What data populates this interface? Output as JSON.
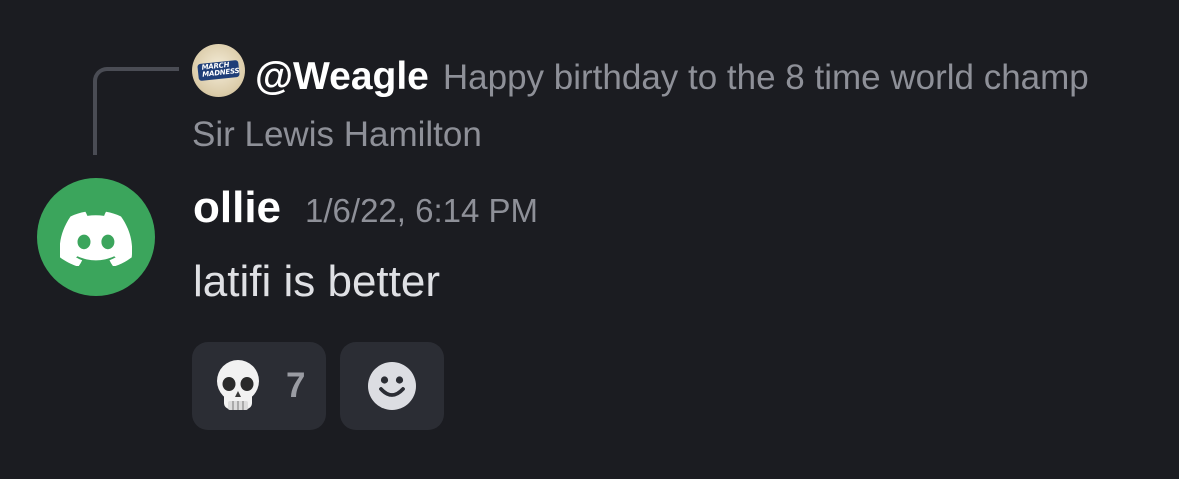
{
  "reply": {
    "author": "@Weagle",
    "avatar_text": "MARCH MADNESS",
    "text": "Happy birthday to the 8 time world champ Sir Lewis Hamilton"
  },
  "message": {
    "avatar_icon": "discord-logo-icon",
    "username": "ollie",
    "timestamp": "1/6/22, 6:14 PM",
    "content": "latifi is better"
  },
  "reactions": [
    {
      "emoji_icon": "skull-icon",
      "count": "7"
    },
    {
      "emoji_icon": "add-reaction-icon"
    }
  ],
  "colors": {
    "background": "#1b1c21",
    "avatar_green": "#3ba55c",
    "reaction_bg": "#2b2d34",
    "muted_text": "#8e9098"
  }
}
